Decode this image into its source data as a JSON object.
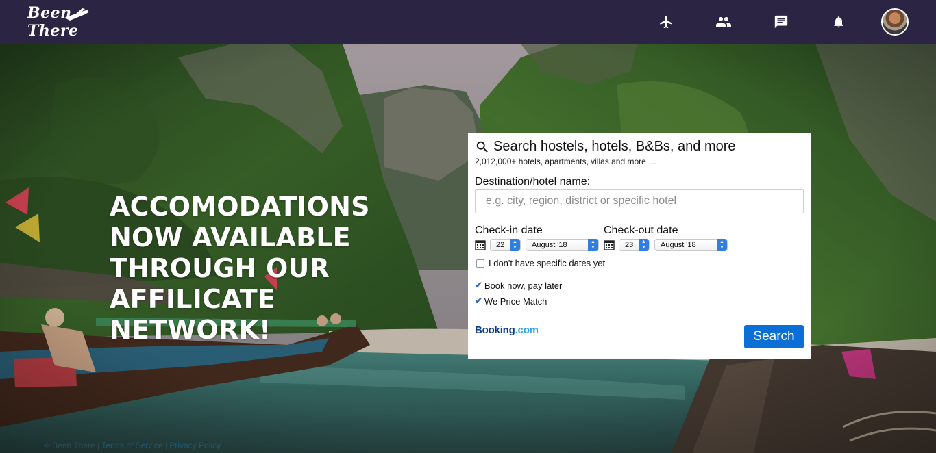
{
  "navbar": {
    "logo_text": "Been There",
    "icons": [
      "plane-icon",
      "people-icon",
      "chat-icon",
      "bell-icon"
    ]
  },
  "hero": {
    "headline": "ACCOMODATIONS NOW AVAILABLE THROUGH OUR AFFILICATE NETWORK!"
  },
  "widget": {
    "title": "Search hostels, hotels, B&Bs, and more",
    "subtitle": "2,012,000+ hotels, apartments, villas and more …",
    "destination_label": "Destination/hotel name:",
    "destination_placeholder": "e.g. city, region, district or specific hotel",
    "destination_value": "",
    "checkin_label": "Check-in date",
    "checkout_label": "Check-out date",
    "checkin_day": "22",
    "checkin_month": "August '18",
    "checkout_day": "23",
    "checkout_month": "August '18",
    "no_dates_label": "I don't have specific dates yet",
    "features": [
      "Book now, pay later",
      "We Price Match"
    ],
    "partner_brand": "Booking",
    "partner_tld": ".com",
    "search_label": "Search"
  },
  "footer": {
    "copyright": "© Been There",
    "links": [
      "Terms of Service",
      "Privacy Policy"
    ]
  },
  "colors": {
    "navbar": "#2b2443",
    "accent": "#0b6fd6"
  }
}
